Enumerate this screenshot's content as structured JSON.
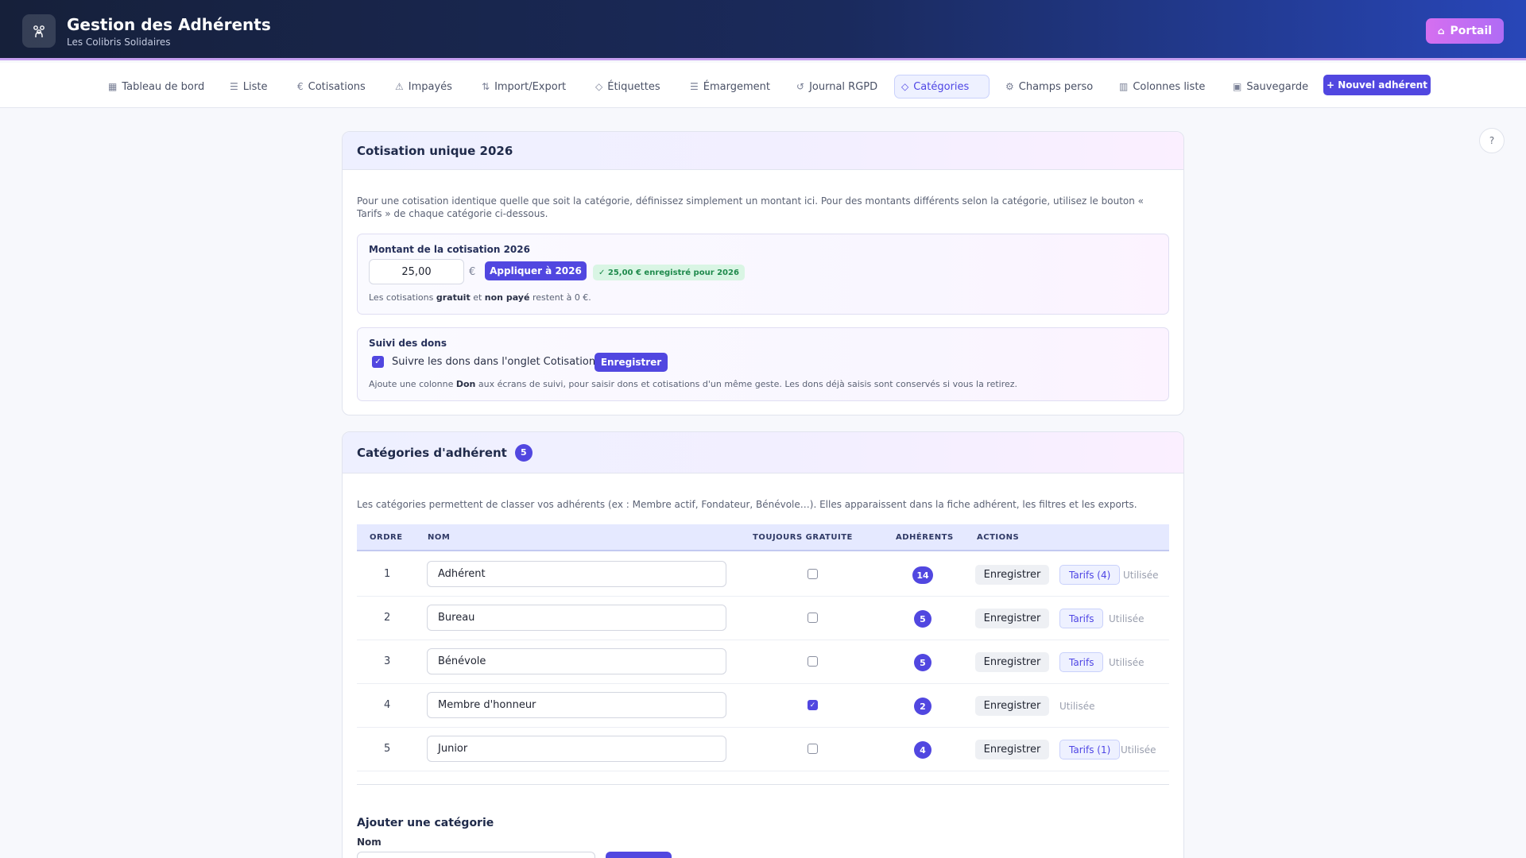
{
  "header": {
    "title": "Gestion des Adhérents",
    "subtitle": "Les Colibris Solidaires",
    "portal_label": "Portail"
  },
  "nav": {
    "items": [
      {
        "label": "Tableau de bord",
        "icon": "dashboard-icon"
      },
      {
        "label": "Liste",
        "icon": "list-icon"
      },
      {
        "label": "Cotisations",
        "icon": "euro-icon"
      },
      {
        "label": "Impayés",
        "icon": "warning-icon"
      },
      {
        "label": "Import/Export",
        "icon": "file-transfer-icon"
      },
      {
        "label": "Étiquettes",
        "icon": "tag-icon"
      },
      {
        "label": "Émargement",
        "icon": "list-check-icon"
      },
      {
        "label": "Journal RGPD",
        "icon": "history-icon"
      },
      {
        "label": "Catégories",
        "icon": "tag-icon"
      },
      {
        "label": "Champs perso",
        "icon": "gear-icon"
      },
      {
        "label": "Colonnes liste",
        "icon": "columns-icon"
      },
      {
        "label": "Sauvegarde",
        "icon": "save-icon"
      }
    ],
    "active": "Catégories",
    "new_member_label": "+ Nouvel adhérent"
  },
  "help_label": "?",
  "cotisation": {
    "title": "Cotisation unique 2026",
    "description_line1": "Pour une cotisation identique quelle que soit la catégorie, définissez simplement un montant ici. Pour des montants différents selon la catégorie, utilisez le bouton «",
    "description_line2": "Tarifs » de chaque catégorie ci-dessous.",
    "amount_label": "Montant de la cotisation 2026",
    "amount_value": "25,00",
    "currency": "€",
    "apply_label": "Appliquer à 2026",
    "saved_badge": "✓ 25,00 € enregistré pour 2026",
    "note_pre": "Les cotisations",
    "note_b1": "gratuit",
    "note_mid": "et",
    "note_b2": "non payé",
    "note_post": "restent à 0 €.",
    "dons_label": "Suivi des dons",
    "dons_checkbox_label": "Suivre les dons dans l'onglet Cotisations",
    "dons_checked": true,
    "dons_save_label": "Enregistrer",
    "dons_note_pre": "Ajoute une colonne",
    "dons_note_b": "Don",
    "dons_note_post": "aux écrans de suivi, pour saisir dons et cotisations d'un même geste. Les dons déjà saisis sont conservés si vous la retirez."
  },
  "categories": {
    "title": "Catégories d'adhérent",
    "count": "5",
    "description": "Les catégories permettent de classer vos adhérents (ex : Membre actif, Fondateur, Bénévole…). Elles apparaissent dans la fiche adhérent, les filtres et les exports.",
    "columns": {
      "ordre": "ORDRE",
      "nom": "NOM",
      "gratuite": "TOUJOURS GRATUITE",
      "adherents": "ADHÉRENTS",
      "actions": "ACTIONS"
    },
    "rows": [
      {
        "ordre": "1",
        "nom": "Adhérent",
        "gratuite": false,
        "adherents": "14",
        "save": "Enregistrer",
        "tarifs": "Tarifs (4)",
        "used": "Utilisée"
      },
      {
        "ordre": "2",
        "nom": "Bureau",
        "gratuite": false,
        "adherents": "5",
        "save": "Enregistrer",
        "tarifs": "Tarifs",
        "used": "Utilisée"
      },
      {
        "ordre": "3",
        "nom": "Bénévole",
        "gratuite": false,
        "adherents": "5",
        "save": "Enregistrer",
        "tarifs": "Tarifs",
        "used": "Utilisée"
      },
      {
        "ordre": "4",
        "nom": "Membre d'honneur",
        "gratuite": true,
        "adherents": "2",
        "save": "Enregistrer",
        "tarifs": "",
        "used": "Utilisée"
      },
      {
        "ordre": "5",
        "nom": "Junior",
        "gratuite": false,
        "adherents": "4",
        "save": "Enregistrer",
        "tarifs": "Tarifs (1)",
        "used": "Utilisée"
      }
    ],
    "add_title": "Ajouter une catégorie",
    "add_name_label": "Nom"
  }
}
